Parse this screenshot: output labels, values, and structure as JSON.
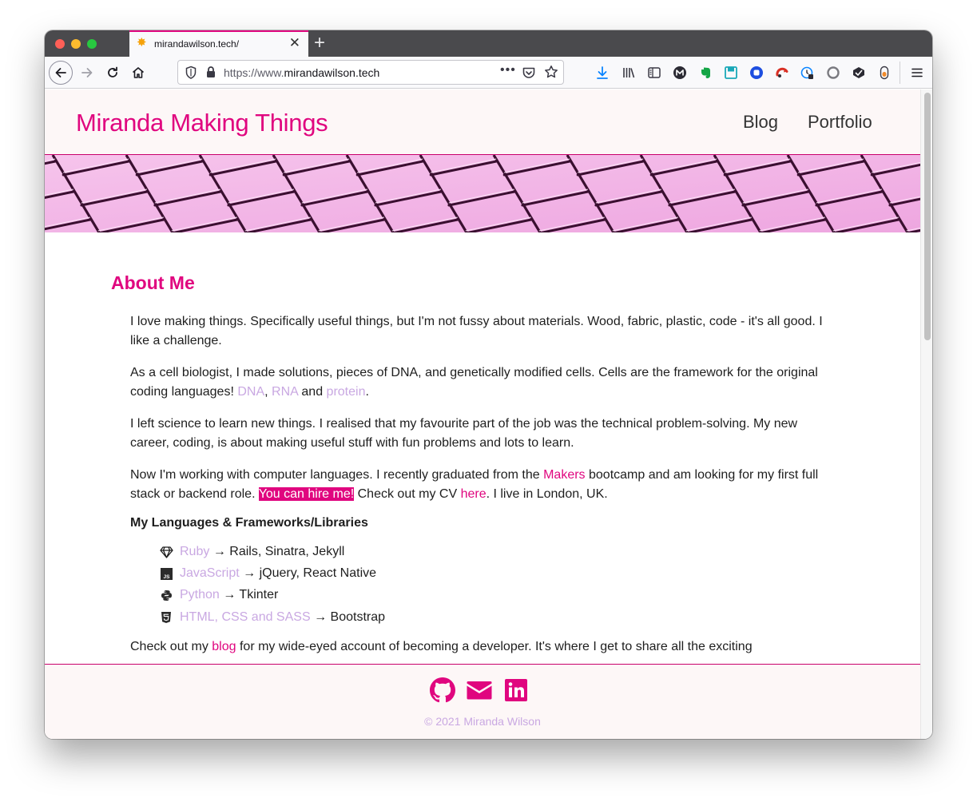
{
  "browser": {
    "tab_title": "mirandawilson.tech/",
    "url_prefix": "https://www.",
    "url_domain": "mirandawilson.tech",
    "new_tab": "+",
    "tab_close": "✕",
    "url_more": "•••"
  },
  "site": {
    "title": "Miranda Making Things",
    "nav": {
      "blog": "Blog",
      "portfolio": "Portfolio"
    }
  },
  "about": {
    "heading": "About Me",
    "p1": "I love making things. Specifically useful things, but I'm not fussy about materials. Wood, fabric, plastic, code - it's all good. I like a challenge.",
    "p2_text": "As a cell biologist, I made solutions, pieces of DNA, and genetically modified cells. Cells are the framework for the original coding languages!",
    "p2_link_dna": "DNA",
    "p2_sep": ",",
    "p2_link_rna": "RNA",
    "p2_and": "and",
    "p2_link_protein": "protein",
    "p2_end": ".",
    "p3": "I left science to learn new things. I realised that my favourite part of the job was the technical problem-solving. My new career, coding, is about making useful stuff with fun problems and lots to learn.",
    "p4_a": "Now I'm working with computer languages. I recently graduated from the",
    "p4_link_makers": "Makers",
    "p4_b": "bootcamp and am looking for my first full stack or backend role.",
    "p4_hire": "You can hire me!",
    "p4_c": "Check out my CV",
    "p4_link_here": "here",
    "p4_d": ". I live in London, UK.",
    "languages_heading": "My Languages & Frameworks/Libraries",
    "languages": [
      {
        "icon": "gem-icon",
        "name": "Ruby",
        "frameworks": "→ Rails, Sinatra, Jekyll"
      },
      {
        "icon": "js-icon",
        "name": "JavaScript",
        "frameworks": "→ jQuery, React Native"
      },
      {
        "icon": "python-icon",
        "name": "Python",
        "frameworks": "→ Tkinter"
      },
      {
        "icon": "html5-icon",
        "name": "HTML, CSS and SASS",
        "frameworks": "→ Bootstrap"
      }
    ],
    "p5_a": "Check out my",
    "p5_link_blog": "blog",
    "p5_b": "for my wide-eyed account of becoming a developer. It's where I get to share all the exciting"
  },
  "footer": {
    "copyright": "© 2021 Miranda Wilson",
    "icons": [
      "github-icon",
      "envelope-icon",
      "linkedin-icon"
    ]
  },
  "colors": {
    "accent": "#e0067f",
    "link_lavender": "#c9a8e2",
    "header_bg": "#fdf7f7",
    "banner": "#f3b8e8"
  }
}
